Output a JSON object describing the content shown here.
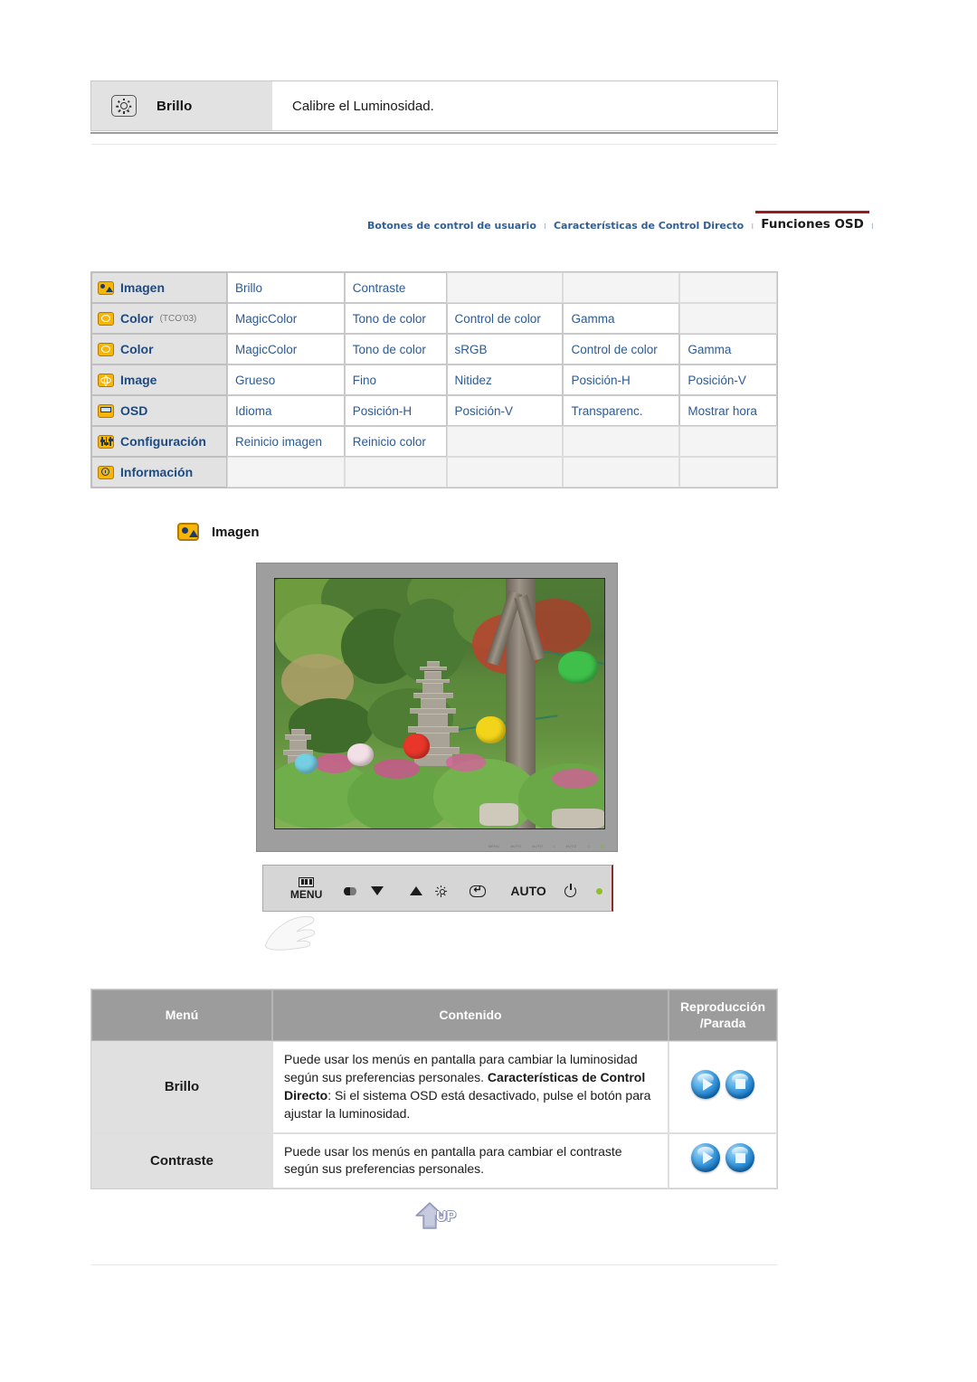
{
  "top_note": {
    "icon": "brightness-sun-icon",
    "label": "Brillo",
    "description": "Calibre el Luminosidad."
  },
  "breadcrumb": {
    "separator": "ı",
    "items": [
      {
        "label": "Botones de control de usuario",
        "active": false
      },
      {
        "label": "Características de Control Directo",
        "active": false
      },
      {
        "label": "Funciones OSD",
        "active": true
      }
    ],
    "accent_color": "#9b1b20",
    "link_color": "#2f5f96"
  },
  "osd_matrix": {
    "rows": [
      {
        "icon": "image-menu-icon",
        "name": "Imagen",
        "suffix": "",
        "items": [
          "Brillo",
          "Contraste",
          "",
          "",
          ""
        ]
      },
      {
        "icon": "color-menu-icon",
        "name": "Color",
        "suffix": "(TCO'03)",
        "items": [
          "MagicColor",
          "Tono de color",
          "Control de color",
          "Gamma",
          ""
        ]
      },
      {
        "icon": "color-menu-icon",
        "name": "Color",
        "suffix": "",
        "items": [
          "MagicColor",
          "Tono de color",
          "sRGB",
          "Control de color",
          "Gamma"
        ]
      },
      {
        "icon": "image-geometry-icon",
        "name": "Image",
        "suffix": "",
        "items": [
          "Grueso",
          "Fino",
          "Nitidez",
          "Posición-H",
          "Posición-V"
        ]
      },
      {
        "icon": "osd-menu-icon",
        "name": "OSD",
        "suffix": "",
        "items": [
          "Idioma",
          "Posición-H",
          "Posición-V",
          "Transparenc.",
          "Mostrar hora"
        ]
      },
      {
        "icon": "setup-menu-icon",
        "name": "Configuración",
        "suffix": "",
        "items": [
          "Reinicio imagen",
          "Reinicio color",
          "",
          "",
          ""
        ]
      },
      {
        "icon": "information-menu-icon",
        "name": "Información",
        "suffix": "",
        "items": [
          "",
          "",
          "",
          "",
          ""
        ]
      }
    ]
  },
  "section": {
    "icon": "image-menu-icon",
    "title": "Imagen"
  },
  "monitor": {
    "bezel_labels": [
      "MENU",
      "AUTO",
      "AUTO",
      "",
      "AUTO",
      "",
      ""
    ],
    "control_buttons": [
      {
        "name": "menu-button",
        "label": "MENU",
        "glyph": "menu-bars-icon"
      },
      {
        "name": "magiccolor-down-button",
        "label": "",
        "glyph": "contrast-down-icon"
      },
      {
        "name": "up-brightness-button",
        "label": "",
        "glyph": "up-brightness-icon"
      },
      {
        "name": "enter-button",
        "label": "",
        "glyph": "enter-icon"
      },
      {
        "name": "auto-button",
        "label": "AUTO",
        "glyph": ""
      },
      {
        "name": "power-button",
        "label": "",
        "glyph": "power-icon"
      },
      {
        "name": "power-led",
        "label": "",
        "glyph": "led-indicator"
      }
    ]
  },
  "bottom_table": {
    "headers": [
      "Menú",
      "Contenido",
      "Reproducción /Parada"
    ],
    "header_reproduccion_line1": "Reproducción",
    "header_reproduccion_line2": "/Parada",
    "rows": [
      {
        "menu": "Brillo",
        "content_part1": "Puede usar los menús en pantalla para cambiar la luminosidad según sus preferencias personales.",
        "content_bold": "Características de Control Directo",
        "content_part2": ": Si el sistema OSD está desactivado, pulse el botón para ajustar la luminosidad.",
        "buttons": [
          "play-button",
          "stop-button"
        ]
      },
      {
        "menu": "Contraste",
        "content_part1": "Puede usar los menús en pantalla para cambiar el contraste según sus preferencias personales.",
        "content_bold": "",
        "content_part2": "",
        "buttons": [
          "play-button",
          "stop-button"
        ]
      }
    ]
  },
  "up_button": {
    "label": "UP",
    "icon": "up-arrow-icon"
  }
}
